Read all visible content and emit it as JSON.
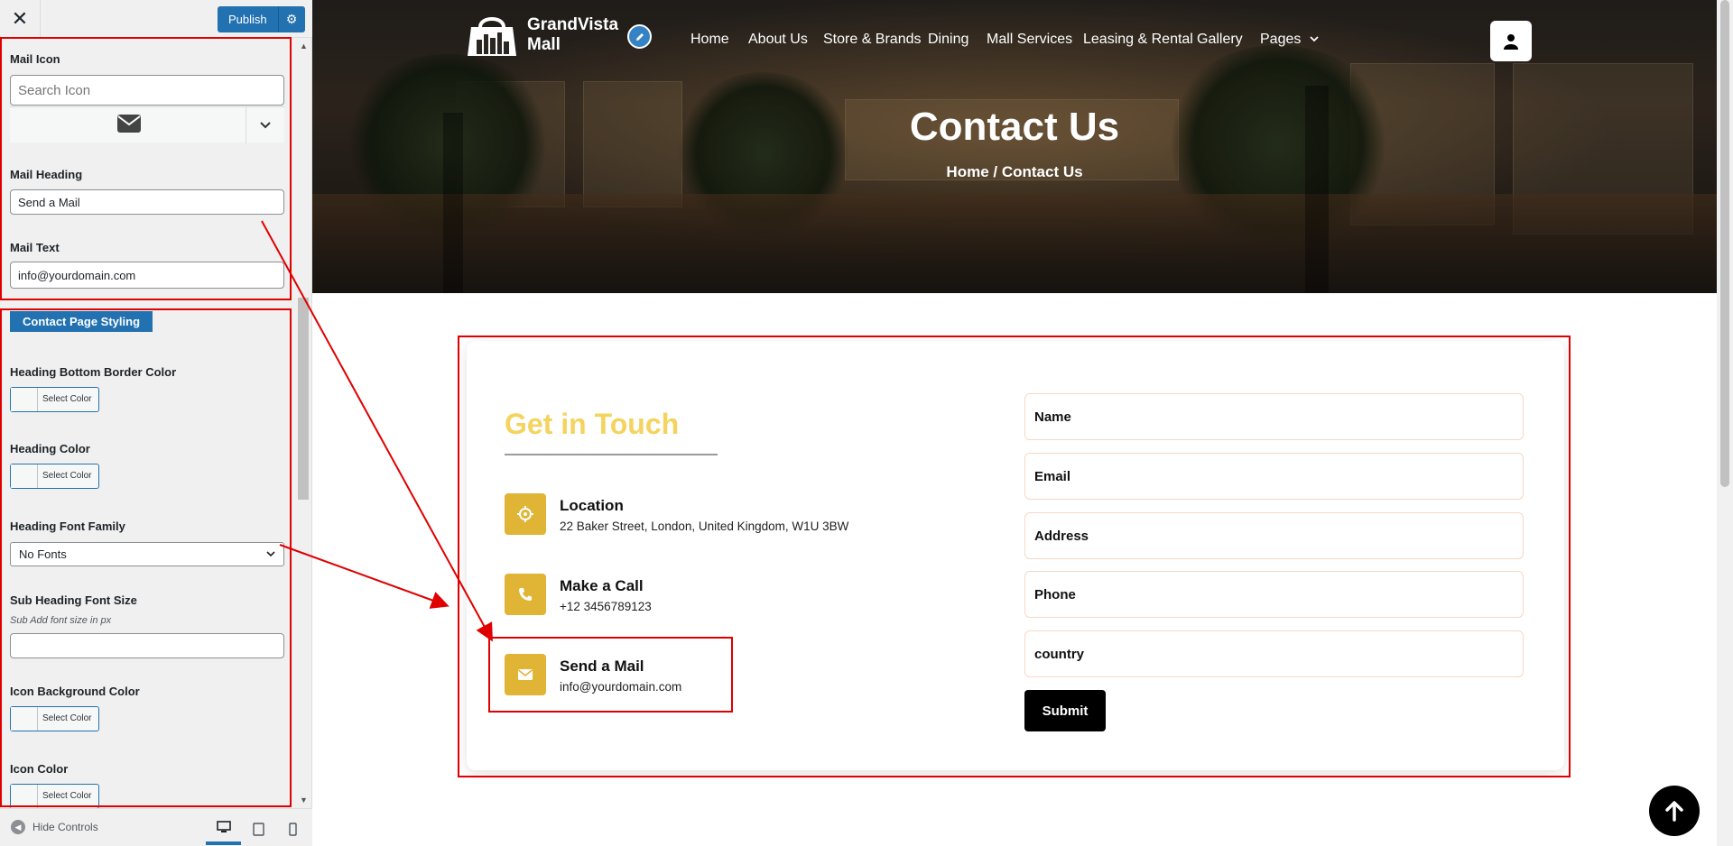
{
  "customizer": {
    "close_label": "✕",
    "publish_label": "Publish",
    "mail_icon": {
      "label": "Mail Icon",
      "search_placeholder": "Search Icon"
    },
    "mail_heading": {
      "label": "Mail Heading",
      "value": "Send a Mail"
    },
    "mail_text": {
      "label": "Mail Text",
      "value": "info@yourdomain.com"
    },
    "section_button": "Contact Page Styling",
    "heading_bottom_border_color": {
      "label": "Heading Bottom Border Color",
      "button": "Select Color"
    },
    "heading_color": {
      "label": "Heading Color",
      "button": "Select Color"
    },
    "heading_font_family": {
      "label": "Heading Font Family",
      "value": "No Fonts"
    },
    "sub_heading_font_size": {
      "label": "Sub Heading Font Size",
      "description": "Sub Add font size in px",
      "value": ""
    },
    "icon_background_color": {
      "label": "Icon Background Color",
      "button": "Select Color"
    },
    "icon_color": {
      "label": "Icon Color",
      "button": "Select Color"
    },
    "footer": {
      "hide_controls": "Hide Controls"
    },
    "accent_color": "#2271b1"
  },
  "site": {
    "brand": {
      "line1": "GrandVista",
      "line2": "Mall"
    },
    "nav": [
      "Home",
      "About Us",
      "Store & Brands",
      "Dining",
      "Mall Services",
      "Leasing & Rental",
      "Gallery",
      "Pages"
    ],
    "hero": {
      "title": "Contact Us",
      "breadcrumb": "Home / Contact Us"
    },
    "contact": {
      "heading": "Get in Touch",
      "heading_color": "#f4d35e",
      "icon_bg": "#e0b434",
      "items": [
        {
          "icon": "location-icon",
          "title": "Location",
          "text": "22 Baker Street, London, United Kingdom, W1U 3BW"
        },
        {
          "icon": "phone-icon",
          "title": "Make a Call",
          "text": "+12 3456789123"
        },
        {
          "icon": "mail-icon",
          "title": "Send a Mail",
          "text": "info@yourdomain.com"
        }
      ],
      "form": {
        "fields": [
          "Name",
          "Email",
          "Address",
          "Phone",
          "country"
        ],
        "submit": "Submit"
      }
    }
  }
}
